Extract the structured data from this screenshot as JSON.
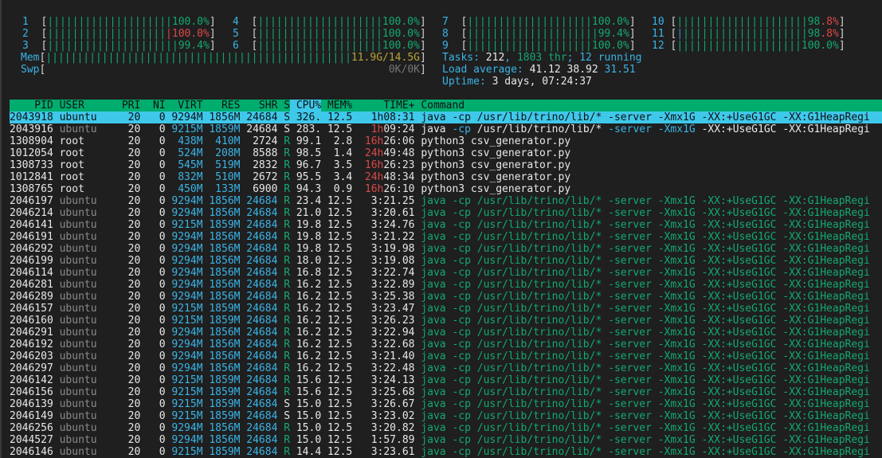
{
  "cpus": [
    {
      "label": "1",
      "value": "100.0%",
      "user": 1.0,
      "kernel": 0,
      "low": 0
    },
    {
      "label": "2",
      "value": "100.0%",
      "user": 0.74,
      "kernel": 0.26,
      "low": 0,
      "value_color": "red"
    },
    {
      "label": "3",
      "value": "99.4%",
      "user": 0.994,
      "kernel": 0,
      "low": 0
    },
    {
      "label": "4",
      "value": "100.0%",
      "user": 1.0,
      "kernel": 0,
      "low": 0
    },
    {
      "label": "5",
      "value": "100.0%",
      "user": 1.0,
      "kernel": 0,
      "low": 0
    },
    {
      "label": "6",
      "value": "100.0%",
      "user": 1.0,
      "kernel": 0,
      "low": 0
    },
    {
      "label": "7",
      "value": "100.0%",
      "user": 1.0,
      "kernel": 0,
      "low": 0
    },
    {
      "label": "8",
      "value": "99.4%",
      "user": 0.994,
      "kernel": 0,
      "low": 0
    },
    {
      "label": "9",
      "value": "100.0%",
      "user": 1.0,
      "kernel": 0,
      "low": 0
    },
    {
      "label": "10",
      "value": "98.8%",
      "user": 0.988,
      "kernel": 0,
      "low": 0,
      "value_color": "split"
    },
    {
      "label": "11",
      "value": "98.8%",
      "user": 0.948,
      "kernel": 0,
      "low": 0.04,
      "value_color": "split"
    },
    {
      "label": "12",
      "value": "100.0%",
      "user": 1.0,
      "kernel": 0,
      "low": 0
    }
  ],
  "mem": {
    "label": "Mem",
    "used_fraction": 0.82,
    "value": "11.9G/14.5G"
  },
  "swp": {
    "label": "Swp",
    "used_fraction": 0,
    "value": "0K/0K"
  },
  "tasks": {
    "label": "Tasks: ",
    "count": "212",
    "sep1": ", ",
    "threads": "1803 thr",
    "sep2": "; ",
    "running": "12",
    "running_label": " running"
  },
  "load": {
    "label": "Load average: ",
    "l1": "41.12",
    "l5": "38.92",
    "l15": "31.51"
  },
  "uptime": {
    "label": "Uptime: ",
    "value": "3 days, 07:24:37"
  },
  "columns": {
    "pid": "PID",
    "user": "USER",
    "pri": "PRI",
    "ni": "NI",
    "virt": "VIRT",
    "res": "RES",
    "shr": "SHR",
    "s": "S",
    "cpu": "CPU%",
    "mem": "MEM%",
    "time": "TIME+",
    "cmd": "Command"
  },
  "colors": {
    "header_bg": "#00ad6f",
    "selected_bg": "#3ec8ea",
    "background": "#1f1f1f"
  },
  "processes": [
    {
      "type": "selected",
      "pid": "2043918",
      "user": "ubuntu",
      "pri": "20",
      "ni": "0",
      "virt": "9294M",
      "res": "1856M",
      "shr": "24684",
      "s": "S",
      "cpu": "326.",
      "mem": "12.5",
      "time": "1h08:31",
      "cmd": "java -cp /usr/lib/trino/lib/* -server -Xmx1G -XX:+UseG1GC -XX:G1HeapRegi"
    },
    {
      "type": "main",
      "pid": "2043916",
      "user": "ubuntu",
      "pri": "20",
      "ni": "0",
      "virt": "9215M",
      "res": "1859M",
      "shr": "24684",
      "s": "S",
      "cpu": "283.",
      "mem": "12.5",
      "time": "1h09:24",
      "cmd": "java -cp /usr/lib/trino/lib/* -server -Xmx1G -XX:+UseG1GC -XX:G1HeapRegi"
    },
    {
      "type": "root",
      "pid": "1308904",
      "user": "root",
      "pri": "20",
      "ni": "0",
      "virt": "438M",
      "res": "410M",
      "shr": "2724",
      "s": "R",
      "cpu": "99.1",
      "mem": "2.8",
      "time": "16h26:06",
      "cmd": "python3 csv_generator.py"
    },
    {
      "type": "root",
      "pid": "1012054",
      "user": "root",
      "pri": "20",
      "ni": "0",
      "virt": "524M",
      "res": "208M",
      "shr": "8588",
      "s": "R",
      "cpu": "98.5",
      "mem": "1.4",
      "time": "24h49:48",
      "cmd": "python3 csv_generator.py"
    },
    {
      "type": "root",
      "pid": "1308733",
      "user": "root",
      "pri": "20",
      "ni": "0",
      "virt": "545M",
      "res": "519M",
      "shr": "2832",
      "s": "R",
      "cpu": "96.7",
      "mem": "3.5",
      "time": "16h26:23",
      "cmd": "python3 csv_generator.py"
    },
    {
      "type": "root",
      "pid": "1012841",
      "user": "root",
      "pri": "20",
      "ni": "0",
      "virt": "832M",
      "res": "510M",
      "shr": "2672",
      "s": "R",
      "cpu": "95.5",
      "mem": "3.4",
      "time": "24h48:34",
      "cmd": "python3 csv_generator.py"
    },
    {
      "type": "root",
      "pid": "1308765",
      "user": "root",
      "pri": "20",
      "ni": "0",
      "virt": "450M",
      "res": "133M",
      "shr": "6900",
      "s": "R",
      "cpu": "94.3",
      "mem": "0.9",
      "time": "16h26:10",
      "cmd": "python3 csv_generator.py"
    },
    {
      "type": "thread",
      "pid": "2046197",
      "user": "ubuntu",
      "pri": "20",
      "ni": "0",
      "virt": "9294M",
      "res": "1856M",
      "shr": "24684",
      "s": "R",
      "cpu": "23.4",
      "mem": "12.5",
      "time": "3:21.25",
      "cmd": "java -cp /usr/lib/trino/lib/* -server -Xmx1G -XX:+UseG1GC -XX:G1HeapRegi"
    },
    {
      "type": "thread",
      "pid": "2046214",
      "user": "ubuntu",
      "pri": "20",
      "ni": "0",
      "virt": "9294M",
      "res": "1856M",
      "shr": "24684",
      "s": "R",
      "cpu": "21.0",
      "mem": "12.5",
      "time": "3:20.61",
      "cmd": "java -cp /usr/lib/trino/lib/* -server -Xmx1G -XX:+UseG1GC -XX:G1HeapRegi"
    },
    {
      "type": "thread",
      "pid": "2046141",
      "user": "ubuntu",
      "pri": "20",
      "ni": "0",
      "virt": "9215M",
      "res": "1859M",
      "shr": "24684",
      "s": "R",
      "cpu": "19.8",
      "mem": "12.5",
      "time": "3:24.76",
      "cmd": "java -cp /usr/lib/trino/lib/* -server -Xmx1G -XX:+UseG1GC -XX:G1HeapRegi"
    },
    {
      "type": "thread",
      "pid": "2046191",
      "user": "ubuntu",
      "pri": "20",
      "ni": "0",
      "virt": "9294M",
      "res": "1856M",
      "shr": "24684",
      "s": "R",
      "cpu": "19.8",
      "mem": "12.5",
      "time": "3:21.22",
      "cmd": "java -cp /usr/lib/trino/lib/* -server -Xmx1G -XX:+UseG1GC -XX:G1HeapRegi"
    },
    {
      "type": "thread",
      "pid": "2046292",
      "user": "ubuntu",
      "pri": "20",
      "ni": "0",
      "virt": "9294M",
      "res": "1856M",
      "shr": "24684",
      "s": "R",
      "cpu": "19.8",
      "mem": "12.5",
      "time": "3:19.98",
      "cmd": "java -cp /usr/lib/trino/lib/* -server -Xmx1G -XX:+UseG1GC -XX:G1HeapRegi"
    },
    {
      "type": "thread",
      "pid": "2046199",
      "user": "ubuntu",
      "pri": "20",
      "ni": "0",
      "virt": "9294M",
      "res": "1856M",
      "shr": "24684",
      "s": "R",
      "cpu": "18.0",
      "mem": "12.5",
      "time": "3:19.08",
      "cmd": "java -cp /usr/lib/trino/lib/* -server -Xmx1G -XX:+UseG1GC -XX:G1HeapRegi"
    },
    {
      "type": "thread",
      "pid": "2046114",
      "user": "ubuntu",
      "pri": "20",
      "ni": "0",
      "virt": "9294M",
      "res": "1856M",
      "shr": "24684",
      "s": "R",
      "cpu": "16.8",
      "mem": "12.5",
      "time": "3:22.74",
      "cmd": "java -cp /usr/lib/trino/lib/* -server -Xmx1G -XX:+UseG1GC -XX:G1HeapRegi"
    },
    {
      "type": "thread",
      "pid": "2046281",
      "user": "ubuntu",
      "pri": "20",
      "ni": "0",
      "virt": "9294M",
      "res": "1856M",
      "shr": "24684",
      "s": "R",
      "cpu": "16.2",
      "mem": "12.5",
      "time": "3:22.89",
      "cmd": "java -cp /usr/lib/trino/lib/* -server -Xmx1G -XX:+UseG1GC -XX:G1HeapRegi"
    },
    {
      "type": "thread",
      "pid": "2046289",
      "user": "ubuntu",
      "pri": "20",
      "ni": "0",
      "virt": "9294M",
      "res": "1856M",
      "shr": "24684",
      "s": "R",
      "cpu": "16.2",
      "mem": "12.5",
      "time": "3:25.38",
      "cmd": "java -cp /usr/lib/trino/lib/* -server -Xmx1G -XX:+UseG1GC -XX:G1HeapRegi"
    },
    {
      "type": "thread",
      "pid": "2046157",
      "user": "ubuntu",
      "pri": "20",
      "ni": "0",
      "virt": "9215M",
      "res": "1859M",
      "shr": "24684",
      "s": "R",
      "cpu": "16.2",
      "mem": "12.5",
      "time": "3:23.47",
      "cmd": "java -cp /usr/lib/trino/lib/* -server -Xmx1G -XX:+UseG1GC -XX:G1HeapRegi"
    },
    {
      "type": "thread",
      "pid": "2046160",
      "user": "ubuntu",
      "pri": "20",
      "ni": "0",
      "virt": "9215M",
      "res": "1859M",
      "shr": "24684",
      "s": "R",
      "cpu": "16.2",
      "mem": "12.5",
      "time": "3:26.23",
      "cmd": "java -cp /usr/lib/trino/lib/* -server -Xmx1G -XX:+UseG1GC -XX:G1HeapRegi"
    },
    {
      "type": "thread",
      "pid": "2046291",
      "user": "ubuntu",
      "pri": "20",
      "ni": "0",
      "virt": "9294M",
      "res": "1856M",
      "shr": "24684",
      "s": "R",
      "cpu": "16.2",
      "mem": "12.5",
      "time": "3:22.94",
      "cmd": "java -cp /usr/lib/trino/lib/* -server -Xmx1G -XX:+UseG1GC -XX:G1HeapRegi"
    },
    {
      "type": "thread",
      "pid": "2046192",
      "user": "ubuntu",
      "pri": "20",
      "ni": "0",
      "virt": "9294M",
      "res": "1856M",
      "shr": "24684",
      "s": "R",
      "cpu": "16.2",
      "mem": "12.5",
      "time": "3:22.68",
      "cmd": "java -cp /usr/lib/trino/lib/* -server -Xmx1G -XX:+UseG1GC -XX:G1HeapRegi"
    },
    {
      "type": "thread",
      "pid": "2046203",
      "user": "ubuntu",
      "pri": "20",
      "ni": "0",
      "virt": "9294M",
      "res": "1856M",
      "shr": "24684",
      "s": "R",
      "cpu": "16.2",
      "mem": "12.5",
      "time": "3:21.40",
      "cmd": "java -cp /usr/lib/trino/lib/* -server -Xmx1G -XX:+UseG1GC -XX:G1HeapRegi"
    },
    {
      "type": "thread",
      "pid": "2046297",
      "user": "ubuntu",
      "pri": "20",
      "ni": "0",
      "virt": "9294M",
      "res": "1856M",
      "shr": "24684",
      "s": "R",
      "cpu": "16.2",
      "mem": "12.5",
      "time": "3:22.48",
      "cmd": "java -cp /usr/lib/trino/lib/* -server -Xmx1G -XX:+UseG1GC -XX:G1HeapRegi"
    },
    {
      "type": "thread",
      "pid": "2046142",
      "user": "ubuntu",
      "pri": "20",
      "ni": "0",
      "virt": "9215M",
      "res": "1859M",
      "shr": "24684",
      "s": "R",
      "cpu": "15.6",
      "mem": "12.5",
      "time": "3:24.13",
      "cmd": "java -cp /usr/lib/trino/lib/* -server -Xmx1G -XX:+UseG1GC -XX:G1HeapRegi"
    },
    {
      "type": "thread",
      "pid": "2046156",
      "user": "ubuntu",
      "pri": "20",
      "ni": "0",
      "virt": "9215M",
      "res": "1859M",
      "shr": "24684",
      "s": "R",
      "cpu": "15.6",
      "mem": "12.5",
      "time": "3:25.68",
      "cmd": "java -cp /usr/lib/trino/lib/* -server -Xmx1G -XX:+UseG1GC -XX:G1HeapRegi"
    },
    {
      "type": "thread",
      "pid": "2046139",
      "user": "ubuntu",
      "pri": "20",
      "ni": "0",
      "virt": "9215M",
      "res": "1859M",
      "shr": "24684",
      "s": "S",
      "cpu": "15.0",
      "mem": "12.5",
      "time": "3:26.67",
      "cmd": "java -cp /usr/lib/trino/lib/* -server -Xmx1G -XX:+UseG1GC -XX:G1HeapRegi"
    },
    {
      "type": "thread",
      "pid": "2046149",
      "user": "ubuntu",
      "pri": "20",
      "ni": "0",
      "virt": "9215M",
      "res": "1859M",
      "shr": "24684",
      "s": "S",
      "cpu": "15.0",
      "mem": "12.5",
      "time": "3:23.02",
      "cmd": "java -cp /usr/lib/trino/lib/* -server -Xmx1G -XX:+UseG1GC -XX:G1HeapRegi"
    },
    {
      "type": "thread",
      "pid": "2046256",
      "user": "ubuntu",
      "pri": "20",
      "ni": "0",
      "virt": "9294M",
      "res": "1856M",
      "shr": "24684",
      "s": "R",
      "cpu": "15.0",
      "mem": "12.5",
      "time": "3:20.82",
      "cmd": "java -cp /usr/lib/trino/lib/* -server -Xmx1G -XX:+UseG1GC -XX:G1HeapRegi"
    },
    {
      "type": "thread",
      "pid": "2044527",
      "user": "ubuntu",
      "pri": "20",
      "ni": "0",
      "virt": "9294M",
      "res": "1856M",
      "shr": "24684",
      "s": "R",
      "cpu": "15.0",
      "mem": "12.5",
      "time": "1:57.89",
      "cmd": "java -cp /usr/lib/trino/lib/* -server -Xmx1G -XX:+UseG1GC -XX:G1HeapRegi"
    },
    {
      "type": "thread",
      "pid": "2046146",
      "user": "ubuntu",
      "pri": "20",
      "ni": "0",
      "virt": "9215M",
      "res": "1859M",
      "shr": "24684",
      "s": "R",
      "cpu": "14.4",
      "mem": "12.5",
      "time": "3:23.61",
      "cmd": "java -cp /usr/lib/trino/lib/* -server -Xmx1G -XX:+UseG1GC -XX:G1HeapRegi"
    }
  ]
}
